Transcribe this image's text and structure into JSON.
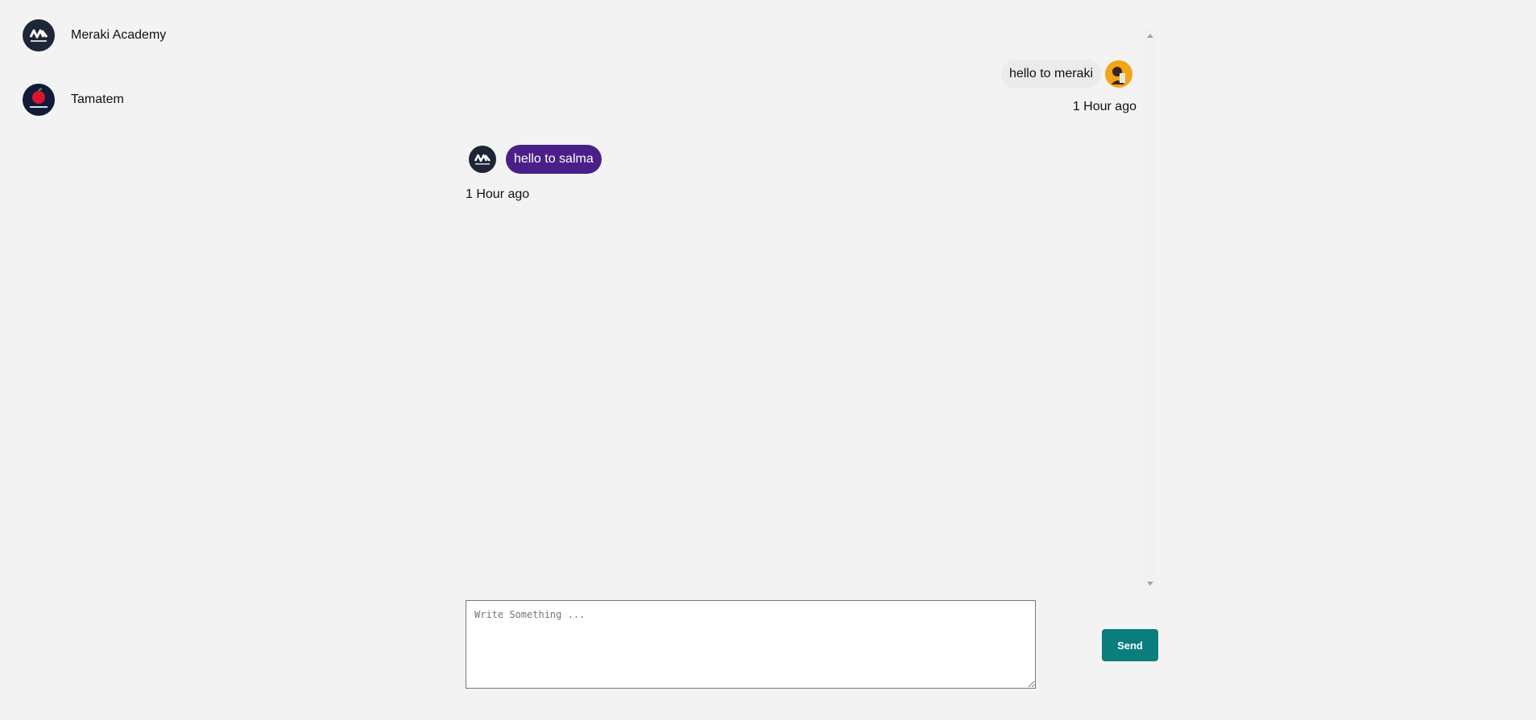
{
  "contacts": [
    {
      "name": "Meraki Academy",
      "avatar_icon": "meraki-academy-logo"
    },
    {
      "name": "Tamatem",
      "avatar_icon": "tamatem-logo"
    }
  ],
  "messages": [
    {
      "direction": "outgoing",
      "text": "hello to meraki",
      "time": "1 Hour ago",
      "avatar_icon": "user-avatar"
    },
    {
      "direction": "incoming",
      "text": "hello to salma",
      "time": "1 Hour ago",
      "avatar_icon": "meraki-academy-logo"
    }
  ],
  "composer": {
    "placeholder": "Write Something ...",
    "send_label": "Send"
  },
  "colors": {
    "background": "#f3f3f3",
    "incoming_bubble": "#4a2088",
    "outgoing_bubble": "#ebebeb",
    "send_button": "#0a7d7d",
    "avatar_dark": "#1e2536",
    "user_avatar": "#f2a516"
  }
}
